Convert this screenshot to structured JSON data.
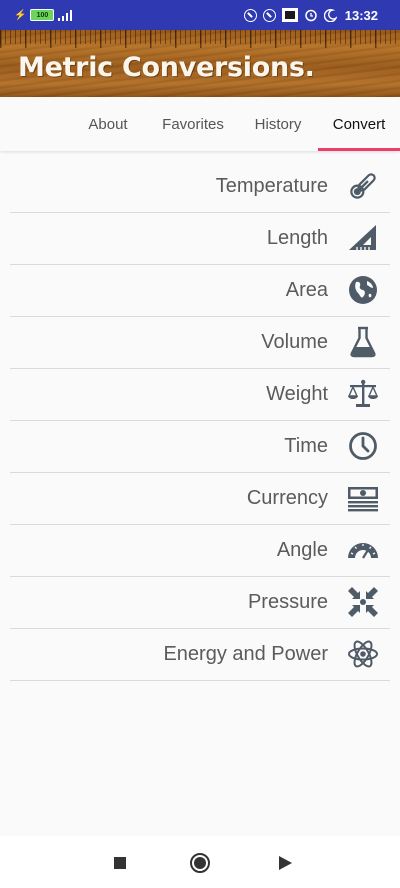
{
  "status_bar": {
    "battery": "100",
    "time": "13:32"
  },
  "app": {
    "title": "Metric Conversions."
  },
  "tabs": [
    {
      "label": "About"
    },
    {
      "label": "Favorites"
    },
    {
      "label": "History"
    },
    {
      "label": "Convert",
      "active": true
    }
  ],
  "categories": [
    {
      "label": "Temperature",
      "icon": "thermometer-icon"
    },
    {
      "label": "Length",
      "icon": "ruler-triangle-icon"
    },
    {
      "label": "Area",
      "icon": "globe-icon"
    },
    {
      "label": "Volume",
      "icon": "flask-icon"
    },
    {
      "label": "Weight",
      "icon": "scale-icon"
    },
    {
      "label": "Time",
      "icon": "clock-icon"
    },
    {
      "label": "Currency",
      "icon": "money-icon"
    },
    {
      "label": "Angle",
      "icon": "protractor-icon"
    },
    {
      "label": "Pressure",
      "icon": "compress-icon"
    },
    {
      "label": "Energy and Power",
      "icon": "atom-icon"
    }
  ],
  "colors": {
    "status_bar": "#2f3ab2",
    "tab_indicator": "#ec3d6d",
    "icon": "#4f5b66"
  }
}
